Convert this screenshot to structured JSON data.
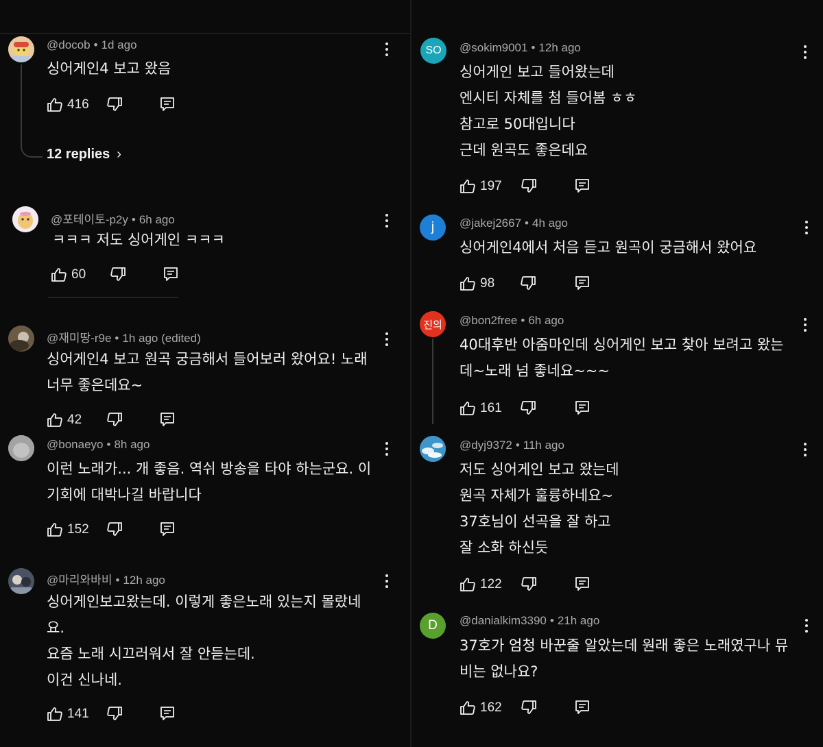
{
  "colors": {
    "background": "#0b0b0b",
    "text": "#f1f1f1",
    "meta": "#aaaaaa",
    "avatar_so": "#1aa5b8",
    "avatar_j": "#1e7fd6",
    "avatar_jin": "#e2321f",
    "avatar_d": "#5aa02c"
  },
  "left": [
    {
      "author": "@docob",
      "time": "1d ago",
      "text": "싱어게인4 보고 왔음",
      "likes": "416",
      "replies": "12 replies"
    },
    {
      "author": "@포테이토-p2y",
      "time": "6h ago",
      "text": "ㅋㅋㅋ 저도 싱어게인 ㅋㅋㅋ",
      "likes": "60"
    },
    {
      "author": "@재미땅-r9e",
      "time": "1h ago (edited)",
      "text": "싱어게인4 보고 원곡 궁금해서 들어보러 왔어요! 노래\n너무 좋은데요~",
      "likes": "42"
    },
    {
      "author": "@bonaeyo",
      "time": "8h ago",
      "text": "이런 노래가... 개 좋음. 역쉬 방송을 타야 하는군요. 이\n기회에 대박나길 바랍니다",
      "likes": "152"
    },
    {
      "author": "@마리와바비",
      "time": "12h ago",
      "text": "싱어게인보고왔는데. 이렇게 좋은노래 있는지 몰랐네\n요.\n요즘 노래 시끄러워서 잘 안듣는데.\n이건 신나네.",
      "likes": "141"
    }
  ],
  "right": [
    {
      "author": "@sokim9001",
      "time": "12h ago",
      "avatar_text": "SO",
      "text": "싱어게인 보고 들어왔는데\n엔시티 자체를 첨 들어봄 ㅎㅎ\n참고로 50대입니다\n근데 원곡도 좋은데요",
      "likes": "197"
    },
    {
      "author": "@jakej2667",
      "time": "4h ago",
      "avatar_text": "j",
      "text": "싱어게인4에서 처음 듣고 원곡이 궁금해서 왔어요",
      "likes": "98"
    },
    {
      "author": "@bon2free",
      "time": "6h ago",
      "avatar_text": "진의",
      "text": "40대후반 아줌마인데 싱어게인 보고 찾아 보려고 왔는\n데~노래 넘 좋네요~~~",
      "likes": "161"
    },
    {
      "author": "@dyj9372",
      "time": "11h ago",
      "text": "저도 싱어게인 보고 왔는데\n원곡 자체가 훌륭하네요~\n37호님이 선곡을 잘 하고\n잘 소화 하신듯",
      "likes": "122"
    },
    {
      "author": "@danialkim3390",
      "time": "21h ago",
      "avatar_text": "D",
      "text": "37호가 엄청 바꾼줄 알았는데 원래 좋은 노래였구나 뮤\n비는 없나요?",
      "likes": "162"
    }
  ]
}
